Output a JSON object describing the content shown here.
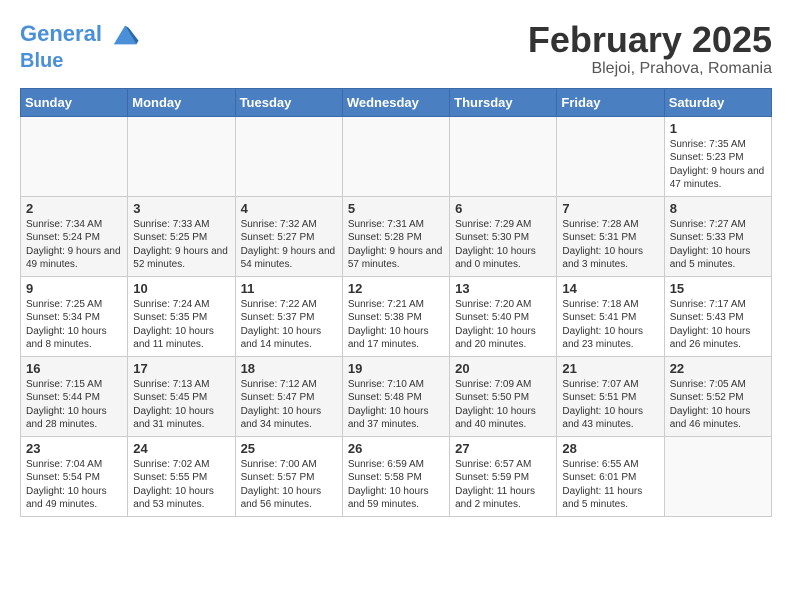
{
  "header": {
    "logo_line1": "General",
    "logo_line2": "Blue",
    "month": "February 2025",
    "location": "Blejoi, Prahova, Romania"
  },
  "weekdays": [
    "Sunday",
    "Monday",
    "Tuesday",
    "Wednesday",
    "Thursday",
    "Friday",
    "Saturday"
  ],
  "weeks": [
    [
      {
        "day": "",
        "info": ""
      },
      {
        "day": "",
        "info": ""
      },
      {
        "day": "",
        "info": ""
      },
      {
        "day": "",
        "info": ""
      },
      {
        "day": "",
        "info": ""
      },
      {
        "day": "",
        "info": ""
      },
      {
        "day": "1",
        "info": "Sunrise: 7:35 AM\nSunset: 5:23 PM\nDaylight: 9 hours and 47 minutes."
      }
    ],
    [
      {
        "day": "2",
        "info": "Sunrise: 7:34 AM\nSunset: 5:24 PM\nDaylight: 9 hours and 49 minutes."
      },
      {
        "day": "3",
        "info": "Sunrise: 7:33 AM\nSunset: 5:25 PM\nDaylight: 9 hours and 52 minutes."
      },
      {
        "day": "4",
        "info": "Sunrise: 7:32 AM\nSunset: 5:27 PM\nDaylight: 9 hours and 54 minutes."
      },
      {
        "day": "5",
        "info": "Sunrise: 7:31 AM\nSunset: 5:28 PM\nDaylight: 9 hours and 57 minutes."
      },
      {
        "day": "6",
        "info": "Sunrise: 7:29 AM\nSunset: 5:30 PM\nDaylight: 10 hours and 0 minutes."
      },
      {
        "day": "7",
        "info": "Sunrise: 7:28 AM\nSunset: 5:31 PM\nDaylight: 10 hours and 3 minutes."
      },
      {
        "day": "8",
        "info": "Sunrise: 7:27 AM\nSunset: 5:33 PM\nDaylight: 10 hours and 5 minutes."
      }
    ],
    [
      {
        "day": "9",
        "info": "Sunrise: 7:25 AM\nSunset: 5:34 PM\nDaylight: 10 hours and 8 minutes."
      },
      {
        "day": "10",
        "info": "Sunrise: 7:24 AM\nSunset: 5:35 PM\nDaylight: 10 hours and 11 minutes."
      },
      {
        "day": "11",
        "info": "Sunrise: 7:22 AM\nSunset: 5:37 PM\nDaylight: 10 hours and 14 minutes."
      },
      {
        "day": "12",
        "info": "Sunrise: 7:21 AM\nSunset: 5:38 PM\nDaylight: 10 hours and 17 minutes."
      },
      {
        "day": "13",
        "info": "Sunrise: 7:20 AM\nSunset: 5:40 PM\nDaylight: 10 hours and 20 minutes."
      },
      {
        "day": "14",
        "info": "Sunrise: 7:18 AM\nSunset: 5:41 PM\nDaylight: 10 hours and 23 minutes."
      },
      {
        "day": "15",
        "info": "Sunrise: 7:17 AM\nSunset: 5:43 PM\nDaylight: 10 hours and 26 minutes."
      }
    ],
    [
      {
        "day": "16",
        "info": "Sunrise: 7:15 AM\nSunset: 5:44 PM\nDaylight: 10 hours and 28 minutes."
      },
      {
        "day": "17",
        "info": "Sunrise: 7:13 AM\nSunset: 5:45 PM\nDaylight: 10 hours and 31 minutes."
      },
      {
        "day": "18",
        "info": "Sunrise: 7:12 AM\nSunset: 5:47 PM\nDaylight: 10 hours and 34 minutes."
      },
      {
        "day": "19",
        "info": "Sunrise: 7:10 AM\nSunset: 5:48 PM\nDaylight: 10 hours and 37 minutes."
      },
      {
        "day": "20",
        "info": "Sunrise: 7:09 AM\nSunset: 5:50 PM\nDaylight: 10 hours and 40 minutes."
      },
      {
        "day": "21",
        "info": "Sunrise: 7:07 AM\nSunset: 5:51 PM\nDaylight: 10 hours and 43 minutes."
      },
      {
        "day": "22",
        "info": "Sunrise: 7:05 AM\nSunset: 5:52 PM\nDaylight: 10 hours and 46 minutes."
      }
    ],
    [
      {
        "day": "23",
        "info": "Sunrise: 7:04 AM\nSunset: 5:54 PM\nDaylight: 10 hours and 49 minutes."
      },
      {
        "day": "24",
        "info": "Sunrise: 7:02 AM\nSunset: 5:55 PM\nDaylight: 10 hours and 53 minutes."
      },
      {
        "day": "25",
        "info": "Sunrise: 7:00 AM\nSunset: 5:57 PM\nDaylight: 10 hours and 56 minutes."
      },
      {
        "day": "26",
        "info": "Sunrise: 6:59 AM\nSunset: 5:58 PM\nDaylight: 10 hours and 59 minutes."
      },
      {
        "day": "27",
        "info": "Sunrise: 6:57 AM\nSunset: 5:59 PM\nDaylight: 11 hours and 2 minutes."
      },
      {
        "day": "28",
        "info": "Sunrise: 6:55 AM\nSunset: 6:01 PM\nDaylight: 11 hours and 5 minutes."
      },
      {
        "day": "",
        "info": ""
      }
    ]
  ]
}
